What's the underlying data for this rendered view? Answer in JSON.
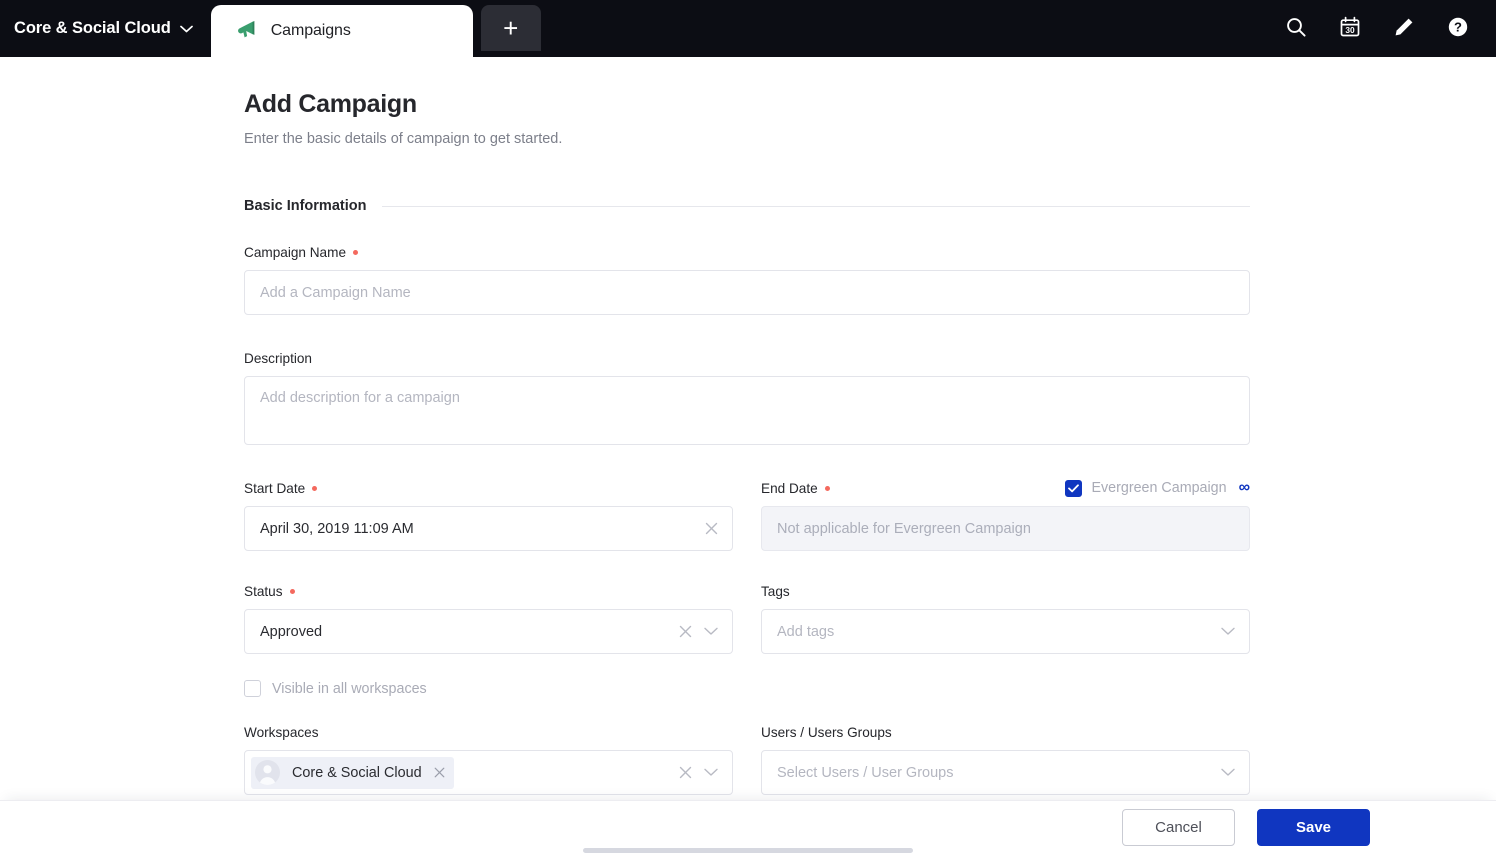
{
  "topbar": {
    "workspace_switcher": {
      "label": "Core & Social Cloud",
      "caret_icon": "chevron-down-icon"
    },
    "tabs": [
      {
        "label": "Campaigns",
        "icon": "megaphone-icon"
      }
    ],
    "add_tab_label": "+",
    "icons": [
      {
        "name": "search-icon",
        "label": "Search"
      },
      {
        "name": "calendar-icon",
        "label": "Calendar",
        "day": "30"
      },
      {
        "name": "compose-icon",
        "label": "Compose"
      },
      {
        "name": "help-icon",
        "label": "Help"
      }
    ]
  },
  "page": {
    "title": "Add Campaign",
    "subtitle": "Enter the basic details of campaign to get started."
  },
  "section": {
    "basic_information": "Basic Information"
  },
  "fields": {
    "campaign_name": {
      "label": "Campaign Name",
      "required": true,
      "value": "",
      "placeholder": "Add a Campaign Name"
    },
    "description": {
      "label": "Description",
      "required": false,
      "value": "",
      "placeholder": "Add description for a campaign"
    },
    "start_date": {
      "label": "Start Date",
      "required": true,
      "value": "April 30, 2019 11:09 AM",
      "clear_icon": "close-icon"
    },
    "end_date": {
      "label": "End Date",
      "required": true,
      "value": "",
      "placeholder": "Not applicable for Evergreen Campaign",
      "disabled": true
    },
    "evergreen": {
      "label": "Evergreen Campaign",
      "checked": true,
      "badge": "∞"
    },
    "status": {
      "label": "Status",
      "required": true,
      "value": "Approved",
      "clear_icon": "close-icon",
      "dropdown_icon": "chevron-down-icon"
    },
    "tags": {
      "label": "Tags",
      "required": false,
      "value": "",
      "placeholder": "Add tags",
      "dropdown_icon": "chevron-down-icon"
    },
    "visible_all_workspaces": {
      "label": "Visible in all workspaces",
      "checked": false
    },
    "workspaces": {
      "label": "Workspaces",
      "chips": [
        {
          "label": "Core & Social Cloud",
          "avatar": "user-avatar",
          "remove_icon": "close-icon"
        }
      ],
      "clear_icon": "close-icon",
      "dropdown_icon": "chevron-down-icon"
    },
    "users_groups": {
      "label": "Users / Users Groups",
      "value": "",
      "placeholder": "Select Users / User Groups",
      "dropdown_icon": "chevron-down-icon"
    }
  },
  "footer": {
    "cancel_label": "Cancel",
    "save_label": "Save"
  },
  "colors": {
    "accent_blue": "#1036c0",
    "required_dot": "#f4695e",
    "topbar_bg": "#0c0d14",
    "tab_icon_green": "#3a9e6e"
  }
}
